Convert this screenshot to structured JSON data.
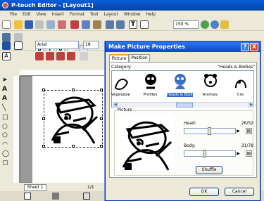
{
  "app": {
    "title": "P-touch Editor - [Layout1]",
    "menu": [
      "File",
      "Edit",
      "View",
      "Insert",
      "Format",
      "Tool",
      "Layout",
      "Window",
      "Help"
    ],
    "zoom": "150 %",
    "font": "Arial",
    "font_size": "18",
    "sheet_tab": "Sheet 1",
    "page_indicator": "1/1"
  },
  "dialog": {
    "title": "Make Picture Properties",
    "tabs": [
      "Picture",
      "Position"
    ],
    "category_label": "Category:",
    "category_value": "\"Heads & Bodies\"",
    "categories": [
      "Vegetable",
      "Profiles",
      "Heads & Bodies",
      "Animals",
      "Cre"
    ],
    "picture_group_label": "Picture",
    "head_label": "Head:",
    "head_value": "26/52",
    "head_level": 0.5,
    "body_label": "Body:",
    "body_value": "31/78",
    "body_level": 0.4,
    "shuffle_label": "Shuffle",
    "ok_label": "OK",
    "cancel_label": "Cancel",
    "help_label": "?",
    "close_label": "X"
  },
  "colors": {
    "title_bar": "#0a46c9",
    "selection": "#316ac5",
    "close": "#d9452b"
  }
}
